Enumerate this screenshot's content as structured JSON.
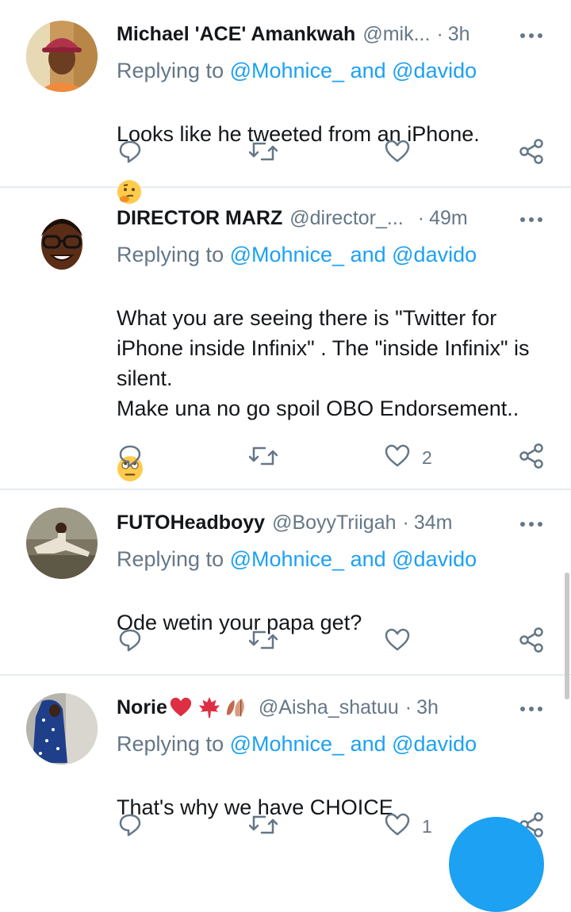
{
  "tweets": [
    {
      "name": "Michael 'ACE' Amankwah",
      "handle": "@mik...",
      "time": "3h",
      "replying_prefix": "Replying to ",
      "mention1": "@Mohnice_",
      "connector": " and ",
      "mention2": "@davido",
      "text": "Looks like he tweeted from an iPhone.",
      "emoji": "thinking-face",
      "likes": ""
    },
    {
      "name": "DIRECTOR MARZ",
      "handle": "@director_...",
      "time": "49m",
      "replying_prefix": "Replying to ",
      "mention1": "@Mohnice_",
      "connector": " and ",
      "mention2": "@davido",
      "text": "What you are seeing there is \"Twitter for iPhone inside Infinix\" . The \"inside Infinix\" is silent.\nMake una no go spoil OBO Endorsement..",
      "emoji": "eye-roll-face",
      "likes": "2"
    },
    {
      "name": "FUTOHeadboyy",
      "handle": "@BoyyTriigah",
      "time": "34m",
      "replying_prefix": "Replying to ",
      "mention1": "@Mohnice_",
      "connector": " and ",
      "mention2": "@davido",
      "text": "Ode wetin your papa get?",
      "emoji": "",
      "likes": ""
    },
    {
      "name": "Norie",
      "name_emojis": [
        "red-heart",
        "maple-leaf",
        "fallen-leaves"
      ],
      "handle": "@Aisha_shatuu",
      "time": "3h",
      "replying_prefix": "Replying to ",
      "mention1": "@Mohnice_",
      "connector": " and ",
      "mention2": "@davido",
      "text": "That's why we have CHOICE",
      "emoji": "",
      "likes": "1"
    }
  ],
  "separator": "·",
  "icons": [
    "reply-icon",
    "retweet-icon",
    "like-icon",
    "share-icon",
    "more-icon"
  ],
  "colors": {
    "accent": "#1da1f2",
    "muted": "#657786",
    "text": "#14171a",
    "heart": "#e0245e"
  }
}
